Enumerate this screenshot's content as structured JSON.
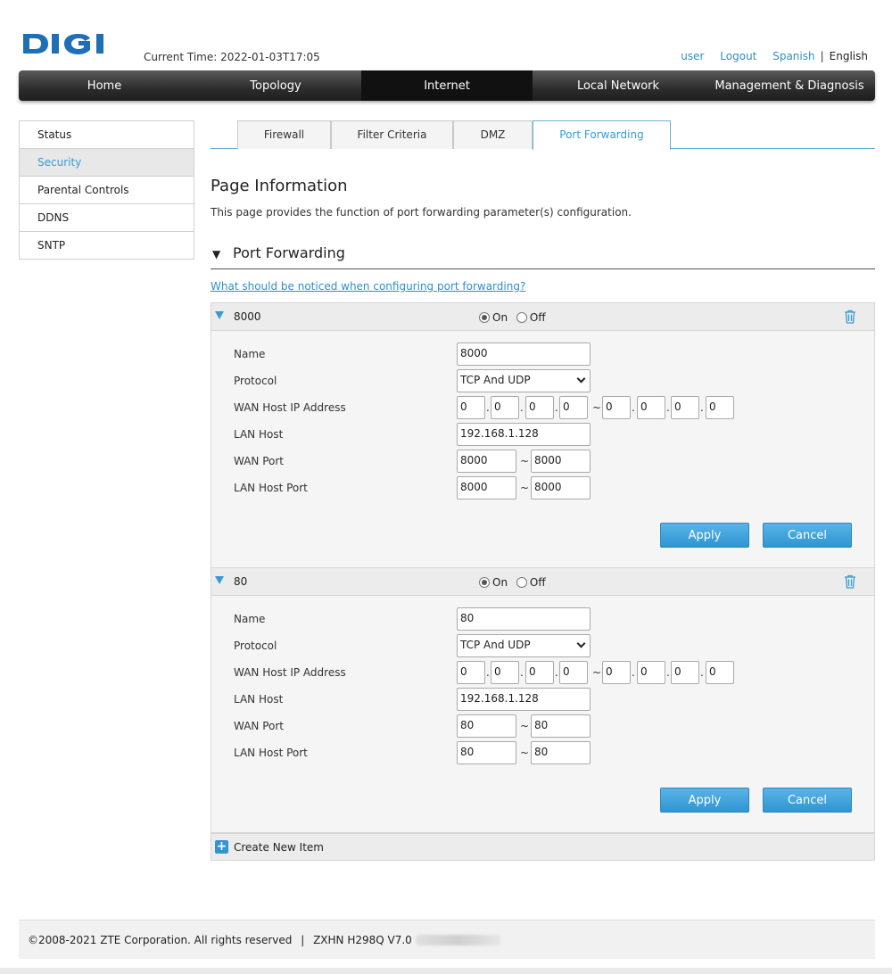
{
  "brand": {
    "logo_text": "DIGI",
    "logo_color": "#1f6fb6"
  },
  "header": {
    "current_time_label": "Current Time: 2022-01-03T17:05",
    "user_link": "user",
    "logout_link": "Logout",
    "lang_spanish": "Spanish",
    "lang_separator": "|",
    "lang_english": "English"
  },
  "nav": {
    "items": [
      {
        "label": "Home"
      },
      {
        "label": "Topology"
      },
      {
        "label": "Internet"
      },
      {
        "label": "Local Network"
      },
      {
        "label": "Management & Diagnosis"
      }
    ],
    "active": "Internet"
  },
  "sidebar": {
    "items": [
      {
        "label": "Status"
      },
      {
        "label": "Security"
      },
      {
        "label": "Parental Controls"
      },
      {
        "label": "DDNS"
      },
      {
        "label": "SNTP"
      }
    ],
    "active": "Security"
  },
  "tabs": {
    "items": [
      {
        "label": "Firewall"
      },
      {
        "label": "Filter Criteria"
      },
      {
        "label": "DMZ"
      },
      {
        "label": "Port Forwarding"
      }
    ],
    "active": "Port Forwarding"
  },
  "page_info": {
    "title": "Page Information",
    "description": "This page provides the function of port forwarding parameter(s) configuration."
  },
  "section": {
    "title": "Port Forwarding",
    "help_link": "What should be noticed when configuring port forwarding?"
  },
  "labels": {
    "on": "On",
    "off": "Off",
    "name": "Name",
    "protocol": "Protocol",
    "wan_host_ip": "WAN Host IP Address",
    "lan_host": "LAN Host",
    "wan_port": "WAN Port",
    "lan_host_port": "LAN Host Port",
    "tilde": "~",
    "dot": ".",
    "apply": "Apply",
    "cancel": "Cancel"
  },
  "rules": [
    {
      "title": "8000",
      "enabled": "On",
      "name": "8000",
      "protocol": "TCP And UDP",
      "wan_ip_start": [
        "0",
        "0",
        "0",
        "0"
      ],
      "wan_ip_end": [
        "0",
        "0",
        "0",
        "0"
      ],
      "lan_host": "192.168.1.128",
      "wan_port_start": "8000",
      "wan_port_end": "8000",
      "lan_port_start": "8000",
      "lan_port_end": "8000"
    },
    {
      "title": "80",
      "enabled": "On",
      "name": "80",
      "protocol": "TCP And UDP",
      "wan_ip_start": [
        "0",
        "0",
        "0",
        "0"
      ],
      "wan_ip_end": [
        "0",
        "0",
        "0",
        "0"
      ],
      "lan_host": "192.168.1.128",
      "wan_port_start": "80",
      "wan_port_end": "80",
      "lan_port_start": "80",
      "lan_port_end": "80"
    }
  ],
  "create_new": "Create New Item",
  "footer": {
    "copyright": "©2008-2021 ZTE Corporation. All rights reserved",
    "separator": "|",
    "model": "ZXHN H298Q V7.0"
  },
  "icons": {
    "trash": "trash-icon",
    "caret": "caret-down-icon",
    "plus": "plus-icon",
    "chevron": "chevron-down-icon"
  }
}
